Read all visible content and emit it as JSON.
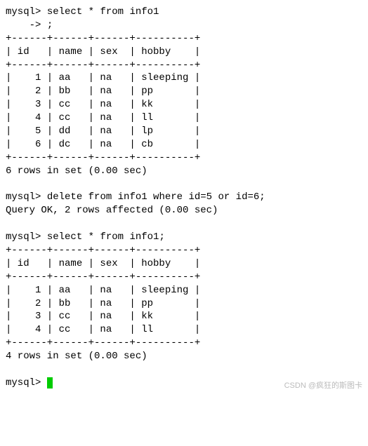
{
  "session": {
    "prompt": "mysql>",
    "continuation": "    ->",
    "query1_line1": "select * from info1",
    "query1_line2": ";",
    "table1": {
      "border": "+------+------+------+----------+",
      "header": "| id   | name | sex  | hobby    |",
      "rows": [
        "|    1 | aa   | na   | sleeping |",
        "|    2 | bb   | na   | pp       |",
        "|    3 | cc   | na   | kk       |",
        "|    4 | cc   | na   | ll       |",
        "|    5 | dd   | na   | lp       |",
        "|    6 | dc   | na   | cb       |"
      ],
      "footer": "6 rows in set (0.00 sec)"
    },
    "query2": "delete from info1 where id=5 or id=6;",
    "query2_result": "Query OK, 2 rows affected (0.00 sec)",
    "query3": "select * from info1;",
    "table2": {
      "border": "+------+------+------+----------+",
      "header": "| id   | name | sex  | hobby    |",
      "rows": [
        "|    1 | aa   | na   | sleeping |",
        "|    2 | bb   | na   | pp       |",
        "|    3 | cc   | na   | kk       |",
        "|    4 | cc   | na   | ll       |"
      ],
      "footer": "4 rows in set (0.00 sec)"
    }
  },
  "watermark": "CSDN @疯狂的斯图卡"
}
